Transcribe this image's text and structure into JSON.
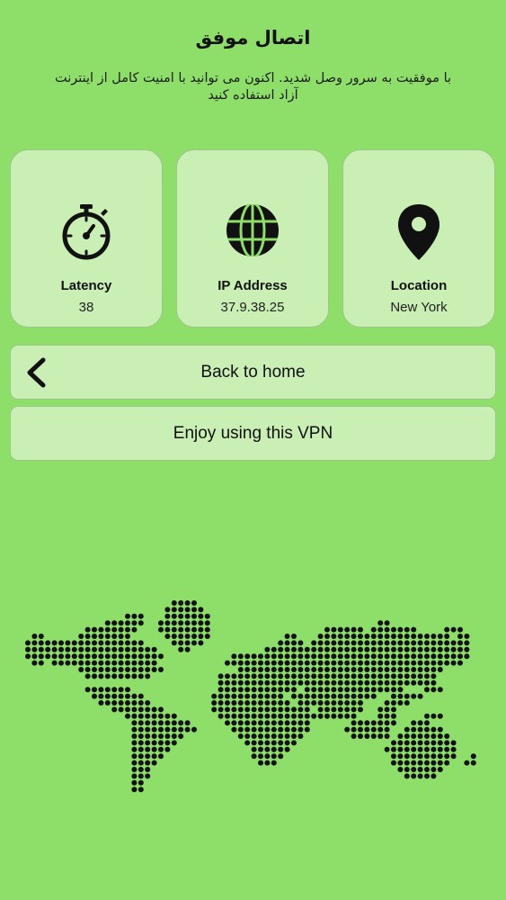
{
  "header": {
    "title": "اتصال موفق",
    "message": "با موفقیت به سرور وصل شدید. اکنون می توانید با امنیت کامل از اینترنت آزاد استفاده کنید"
  },
  "stats": {
    "latency": {
      "label": "Latency",
      "value": "38",
      "icon": "stopwatch-icon"
    },
    "ip": {
      "label": "IP Address",
      "value": "37.9.38.25",
      "icon": "globe-icon"
    },
    "location": {
      "label": "Location",
      "value": "New York",
      "icon": "map-pin-icon"
    }
  },
  "actions": {
    "back_label": "Back to home",
    "back_icon": "chevron-left-icon",
    "enjoy_label": "Enjoy using this VPN"
  },
  "theme": {
    "background": "#8ddf69",
    "card": "#c9efb4",
    "dot": "#111111"
  }
}
